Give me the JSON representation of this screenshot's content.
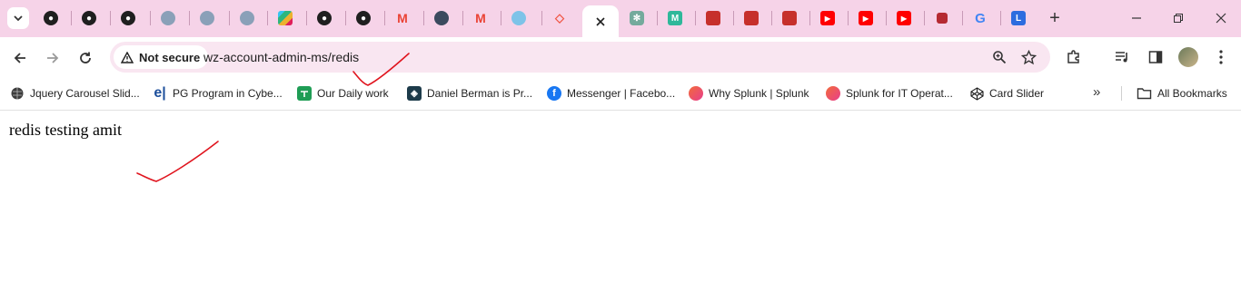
{
  "colors": {
    "tabbar_bg": "#f6d3e8",
    "omnibox_bg": "#f9e6f1",
    "annotation_red": "#e0141e"
  },
  "tabs": [
    {
      "icon": "github-icon"
    },
    {
      "icon": "github-icon"
    },
    {
      "icon": "github-icon"
    },
    {
      "icon": "cloud-logo-icon"
    },
    {
      "icon": "cloud-logo-icon"
    },
    {
      "icon": "cloud-logo-icon"
    },
    {
      "icon": "slack-icon"
    },
    {
      "icon": "github-icon"
    },
    {
      "icon": "github-icon"
    },
    {
      "icon": "gmail-icon"
    },
    {
      "icon": "circle-logo-icon"
    },
    {
      "icon": "gmail-icon"
    },
    {
      "icon": "app-logo-icon"
    },
    {
      "icon": "laravel-icon"
    },
    {
      "icon": "close-icon",
      "active": true
    },
    {
      "icon": "chatgpt-icon"
    },
    {
      "icon": "app-logo-icon"
    },
    {
      "icon": "redis-icon"
    },
    {
      "icon": "redis-icon"
    },
    {
      "icon": "redis-icon"
    },
    {
      "icon": "youtube-icon"
    },
    {
      "icon": "youtube-icon"
    },
    {
      "icon": "youtube-icon"
    },
    {
      "icon": "redis-icon"
    },
    {
      "icon": "google-icon"
    },
    {
      "icon": "app-logo-icon"
    }
  ],
  "toolbar": {
    "security_chip": "Not secure",
    "url": "wz-account-admin-ms/redis"
  },
  "bookmarks": {
    "items": [
      {
        "label": "Jquery Carousel Slid...",
        "icon": "globe-icon"
      },
      {
        "label": "PG Program in Cybe...",
        "icon": "e-logo-icon"
      },
      {
        "label": "Our Daily work",
        "icon": "sheets-icon"
      },
      {
        "label": "Daniel Berman is Pr...",
        "icon": "logo-icon"
      },
      {
        "label": "Messenger | Facebo...",
        "icon": "facebook-icon"
      },
      {
        "label": "Why Splunk | Splunk",
        "icon": "splunk-icon"
      },
      {
        "label": "Splunk for IT Operat...",
        "icon": "splunk-icon"
      },
      {
        "label": "Card Slider",
        "icon": "codepen-icon"
      }
    ],
    "more": "»",
    "all_bookmarks": "All Bookmarks"
  },
  "page": {
    "text": "redis testing amit"
  }
}
